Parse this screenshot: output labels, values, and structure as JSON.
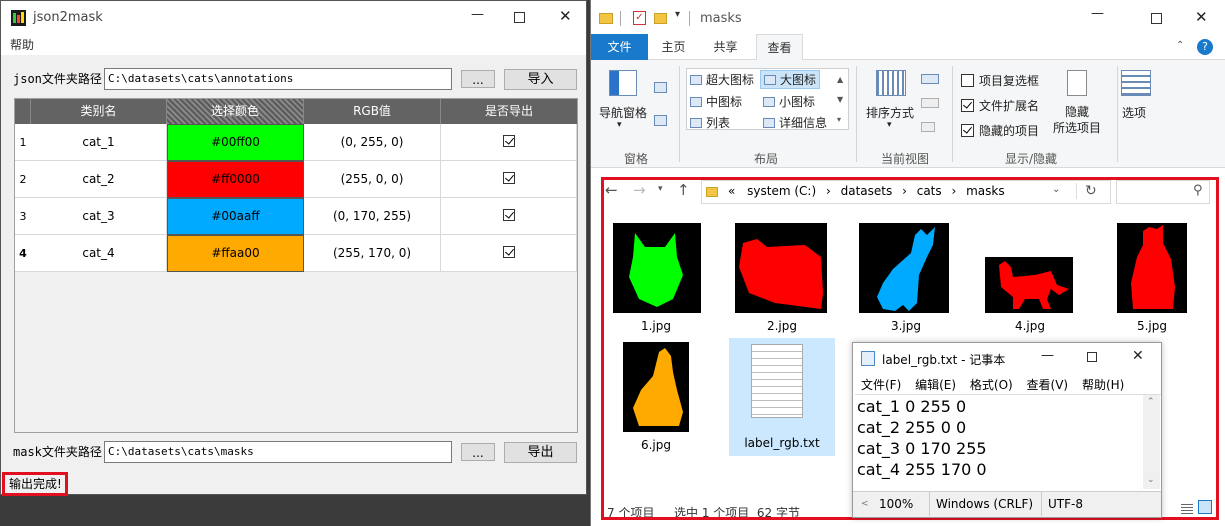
{
  "left_window": {
    "title": "json2mask",
    "menu": [
      "帮助"
    ],
    "json_path_label": "json文件夹路径",
    "json_path_value": "C:\\datasets\\cats\\annotations",
    "browse_label": "...",
    "import_label": "导入",
    "table": {
      "headers": [
        "类别名",
        "选择颜色",
        "RGB值",
        "是否导出"
      ],
      "rows": [
        {
          "num": "1",
          "name": "cat_1",
          "color_hex": "#00ff00",
          "rgb": "(0, 255, 0)"
        },
        {
          "num": "2",
          "name": "cat_2",
          "color_hex": "#ff0000",
          "rgb": "(255, 0, 0)"
        },
        {
          "num": "3",
          "name": "cat_3",
          "color_hex": "#00aaff",
          "rgb": "(0, 170, 255)"
        },
        {
          "num": "4",
          "name": "cat_4",
          "color_hex": "#ffaa00",
          "rgb": "(255, 170, 0)"
        }
      ]
    },
    "mask_path_label": "mask文件夹路径",
    "mask_path_value": "C:\\datasets\\cats\\masks",
    "export_label": "导出",
    "status": "输出完成!"
  },
  "explorer": {
    "title": "masks",
    "tabs": [
      "文件",
      "主页",
      "共享",
      "查看"
    ],
    "ribbon": {
      "nav_pane": "导航窗格",
      "pane_group": "窗格",
      "layout_items": [
        "超大图标",
        "大图标",
        "中图标",
        "小图标",
        "列表",
        "详细信息"
      ],
      "layout_group": "布局",
      "sort_by": "排序方式",
      "current_view_group": "当前视图",
      "checkboxes": [
        "项目复选框",
        "文件扩展名",
        "隐藏的项目"
      ],
      "hide_selected": "隐藏\n所选项目",
      "hide_selected_1": "隐藏",
      "hide_selected_2": "所选项目",
      "show_hide_group": "显示/隐藏",
      "options": "选项"
    },
    "breadcrumb": [
      "«",
      "system (C:)",
      "datasets",
      "cats",
      "masks"
    ],
    "files": [
      "1.jpg",
      "2.jpg",
      "3.jpg",
      "4.jpg",
      "5.jpg",
      "6.jpg",
      "label_rgb.txt"
    ],
    "status_count": "7 个项目",
    "status_selected": "选中 1 个项目  62 字节"
  },
  "notepad": {
    "title": "label_rgb.txt - 记事本",
    "menu": [
      "文件(F)",
      "编辑(E)",
      "格式(O)",
      "查看(V)",
      "帮助(H)"
    ],
    "lines": [
      "cat_1 0 255 0",
      "cat_2 255 0 0",
      "cat_3 0 170 255",
      "cat_4 255 170 0"
    ],
    "zoom": "100%",
    "line_ending": "Windows (CRLF)",
    "encoding": "UTF-8"
  }
}
